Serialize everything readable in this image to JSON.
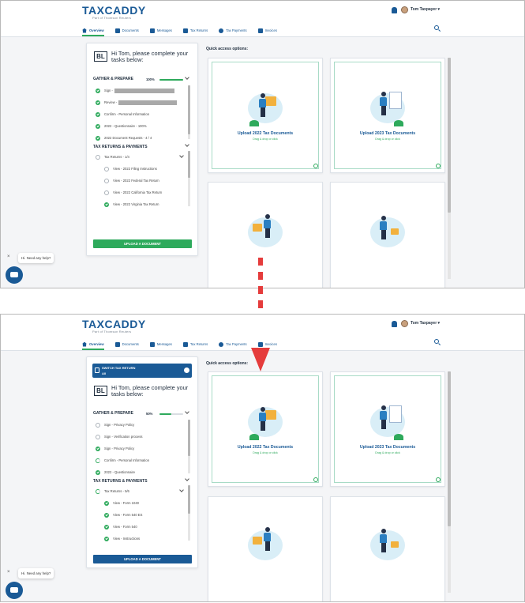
{
  "brand": {
    "logo": "TAXCADDY",
    "tagline": "Part of Thomson Reuters"
  },
  "user": {
    "name": "Tom Taxpayer"
  },
  "nav": {
    "tabs": [
      "Overview",
      "Documents",
      "Messages",
      "Tax Returns",
      "Tax Payments",
      "Invoices"
    ]
  },
  "colors": {
    "brand_blue": "#1a5a96",
    "accent_green": "#2eaa5c",
    "arrow_red": "#e53c3c"
  },
  "icons": {
    "nav": [
      "home-icon",
      "documents-icon",
      "messages-icon",
      "tax-returns-icon",
      "tax-payments-icon",
      "invoices-icon"
    ]
  },
  "before": {
    "initials": "BL",
    "greeting": "Hi Tom, please complete your tasks below:",
    "gather": {
      "title": "GATHER & PREPARE",
      "progress": "100%",
      "progress_fraction": 1.0
    },
    "gather_tasks": [
      {
        "label": "Sign - ",
        "status": "done",
        "redacted": true
      },
      {
        "label": "Review - ",
        "status": "done",
        "redacted": true
      },
      {
        "label": "Confirm - Personal Information",
        "status": "done"
      },
      {
        "label": "2022 - Questionnaire - 100%",
        "status": "done"
      },
      {
        "label": "2022 Document Requests - 4 / 4",
        "status": "done"
      }
    ],
    "returns": {
      "title": "TAX RETURNS & PAYMENTS"
    },
    "returns_group": {
      "label": "Tax Returns - 1/4",
      "status": "open"
    },
    "return_tasks": [
      {
        "label": "View - 2022 Filing Instructions",
        "status": "open"
      },
      {
        "label": "View - 2022 Federal Tax Return",
        "status": "open"
      },
      {
        "label": "View - 2022 California Tax Return",
        "status": "open"
      },
      {
        "label": "View - 2022 Virginia Tax Return",
        "status": "done"
      }
    ],
    "upload_button": "UPLOAD A DOCUMENT",
    "upload_color": "#2eaa5c"
  },
  "after": {
    "switch": {
      "title": "SWITCH TAX RETURN",
      "value": "All"
    },
    "initials": "BL",
    "greeting": "Hi Tom, please complete your tasks below:",
    "gather": {
      "title": "GATHER & PREPARE",
      "progress": "50%",
      "progress_fraction": 0.5
    },
    "gather_tasks": [
      {
        "label": "Sign - Privacy Policy",
        "status": "open"
      },
      {
        "label": "Sign - Verification process",
        "status": "open"
      },
      {
        "label": "Sign - Privacy Policy",
        "status": "done"
      },
      {
        "label": "Confirm - Personal Information",
        "status": "part"
      },
      {
        "label": "2022 - Questionnaire",
        "status": "done"
      }
    ],
    "returns": {
      "title": "TAX RETURNS & PAYMENTS"
    },
    "returns_group": {
      "label": "Tax Returns - 5/6",
      "status": "part"
    },
    "return_tasks": [
      {
        "label": "View - Form 1040",
        "status": "done"
      },
      {
        "label": "View - Form 540 ES",
        "status": "done"
      },
      {
        "label": "View - Form 540",
        "status": "done"
      },
      {
        "label": "View - Instructions",
        "status": "done"
      }
    ],
    "upload_button": "UPLOAD A DOCUMENT",
    "upload_color": "#1a5a96"
  },
  "quick_access": {
    "title": "Quick access options:",
    "cards": [
      {
        "title": "Upload 2022 Tax Documents",
        "subtitle": "Drag & drop or click"
      },
      {
        "title": "Upload 2023 Tax Documents",
        "subtitle": "Drag & drop or click"
      }
    ]
  },
  "chat": {
    "prompt": "Hi. Need any help?",
    "close": "×"
  }
}
